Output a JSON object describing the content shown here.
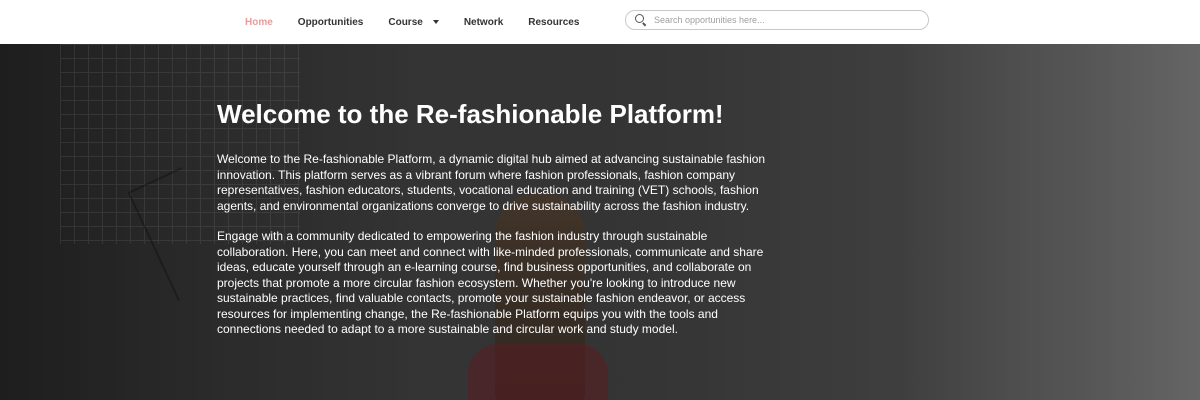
{
  "nav": {
    "items": [
      {
        "label": "Home",
        "active": true
      },
      {
        "label": "Opportunities",
        "active": false
      },
      {
        "label": "Course",
        "active": false,
        "has_dropdown": true
      },
      {
        "label": "Network",
        "active": false
      },
      {
        "label": "Resources",
        "active": false
      }
    ],
    "active_color": "#e99a9a"
  },
  "search": {
    "placeholder": "Search opportunities here...",
    "value": "",
    "icon": "search-icon"
  },
  "hero": {
    "title": "Welcome to the Re-fashionable Platform!",
    "paragraphs": [
      "Welcome to the Re-fashionable Platform, a dynamic digital hub aimed at advancing sustainable fashion innovation. This platform serves as a vibrant forum where fashion professionals, fashion company representatives, fashion educators, students, vocational education and training (VET) schools, fashion agents, and environmental organizations converge to drive sustainability across the fashion industry.",
      "Engage with a community dedicated to empowering the fashion industry through sustainable collaboration. Here, you can meet and connect with like-minded professionals, communicate and share ideas, educate yourself through an e-learning course, find business opportunities, and collaborate on projects that promote a more circular fashion ecosystem. Whether you're looking to introduce new sustainable practices, find valuable contacts, promote your sustainable fashion endeavor, or access resources for implementing change, the Re-fashionable Platform equips you with the tools and connections needed to adapt to a more sustainable and circular work and study model."
    ]
  }
}
